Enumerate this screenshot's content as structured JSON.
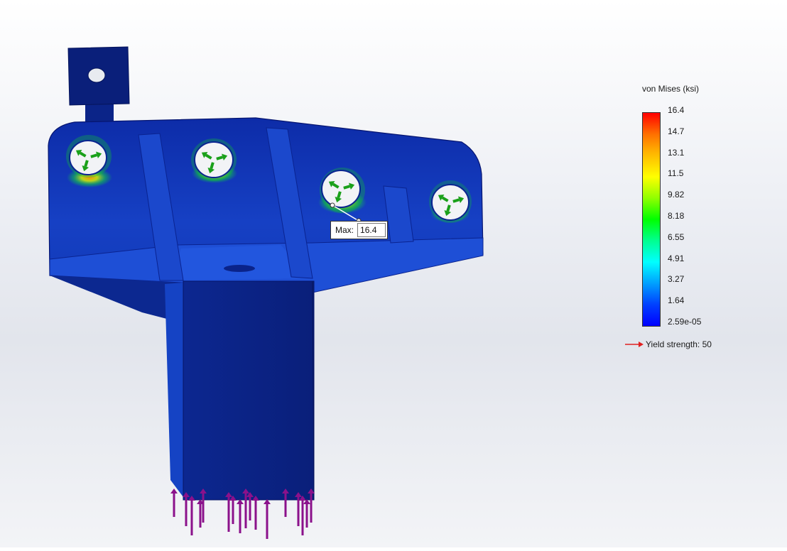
{
  "legend": {
    "title": "von Mises (ksi)",
    "ticks": [
      "16.4",
      "14.7",
      "13.1",
      "11.5",
      "9.82",
      "8.18",
      "6.55",
      "4.91",
      "3.27",
      "1.64",
      "2.59e-05"
    ],
    "yield_label": "Yield strength: 50",
    "max_color": "#ff0000",
    "min_color": "#0000ff"
  },
  "probe": {
    "label": "Max:",
    "value": "16.4"
  },
  "colors": {
    "part_dark": "#0a1e80",
    "part_mid": "#0a2fb5",
    "fixture_arrow": "#1aa01a",
    "load_arrow": "#8b118b",
    "yield_arrow": "#e02020"
  }
}
